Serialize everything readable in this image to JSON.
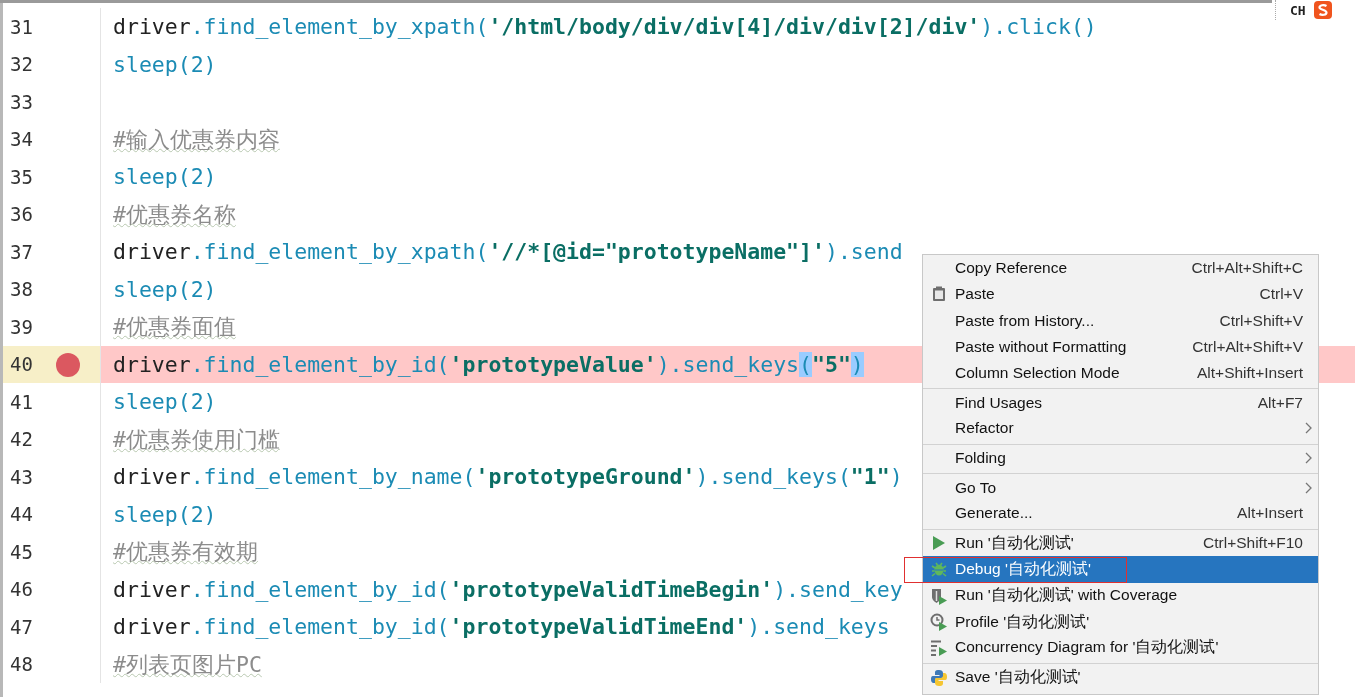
{
  "editor": {
    "lines": [
      {
        "number": "31",
        "breakpoint": false,
        "tokens": [
          {
            "kind": "plain",
            "text": "driver"
          },
          {
            "kind": "method",
            "text": ".find_element_by_xpath("
          },
          {
            "kind": "string",
            "text": "'/html/body/div/div[4]/div/div[2]/div'"
          },
          {
            "kind": "method",
            "text": ").click()"
          }
        ]
      },
      {
        "number": "32",
        "breakpoint": false,
        "tokens": [
          {
            "kind": "method",
            "text": "sleep(2)"
          }
        ]
      },
      {
        "number": "33",
        "breakpoint": false
      },
      {
        "number": "34",
        "breakpoint": false,
        "tokens": [
          {
            "kind": "comment",
            "text": "#输入优惠券内容"
          }
        ]
      },
      {
        "number": "35",
        "breakpoint": false,
        "tokens": [
          {
            "kind": "method",
            "text": "sleep(2)"
          }
        ]
      },
      {
        "number": "36",
        "breakpoint": false,
        "tokens": [
          {
            "kind": "comment",
            "text": "#优惠券名称"
          }
        ]
      },
      {
        "number": "37",
        "breakpoint": false,
        "tokens": [
          {
            "kind": "plain",
            "text": "driver"
          },
          {
            "kind": "method",
            "text": ".find_element_by_xpath("
          },
          {
            "kind": "string",
            "text": "'//*[@id=\"prototypeName\"]'"
          },
          {
            "kind": "method",
            "text": ").send"
          }
        ]
      },
      {
        "number": "38",
        "breakpoint": false,
        "tokens": [
          {
            "kind": "method",
            "text": "sleep(2)"
          }
        ]
      },
      {
        "number": "39",
        "breakpoint": false,
        "tokens": [
          {
            "kind": "comment",
            "text": "#优惠券面值"
          }
        ]
      },
      {
        "number": "40",
        "breakpoint": true,
        "tokens": [
          {
            "kind": "plain",
            "text": "driver"
          },
          {
            "kind": "method",
            "text": ".find_element_by_id("
          },
          {
            "kind": "string",
            "text": "'prototypeValue'"
          },
          {
            "kind": "method",
            "text": ").send_keys"
          },
          {
            "kind": "match",
            "text": "("
          },
          {
            "kind": "string",
            "text": "\"5\""
          },
          {
            "kind": "match",
            "text": ")"
          }
        ]
      },
      {
        "number": "41",
        "breakpoint": false,
        "tokens": [
          {
            "kind": "method",
            "text": "sleep(2)"
          }
        ]
      },
      {
        "number": "42",
        "breakpoint": false,
        "tokens": [
          {
            "kind": "comment",
            "text": "#优惠券使用门槛"
          }
        ]
      },
      {
        "number": "43",
        "breakpoint": false,
        "tokens": [
          {
            "kind": "plain",
            "text": "driver"
          },
          {
            "kind": "method",
            "text": ".find_element_by_name("
          },
          {
            "kind": "string",
            "text": "'prototypeGround'"
          },
          {
            "kind": "method",
            "text": ").send_keys("
          },
          {
            "kind": "string",
            "text": "\"1\""
          },
          {
            "kind": "method",
            "text": ")"
          }
        ]
      },
      {
        "number": "44",
        "breakpoint": false,
        "tokens": [
          {
            "kind": "method",
            "text": "sleep(2)"
          }
        ]
      },
      {
        "number": "45",
        "breakpoint": false,
        "tokens": [
          {
            "kind": "comment",
            "text": "#优惠券有效期"
          }
        ]
      },
      {
        "number": "46",
        "breakpoint": false,
        "tokens": [
          {
            "kind": "plain",
            "text": "driver"
          },
          {
            "kind": "method",
            "text": ".find_element_by_id("
          },
          {
            "kind": "string",
            "text": "'prototypeValidTimeBegin'"
          },
          {
            "kind": "method",
            "text": ").send_key"
          }
        ]
      },
      {
        "number": "47",
        "breakpoint": false,
        "tokens": [
          {
            "kind": "plain",
            "text": "driver"
          },
          {
            "kind": "method",
            "text": ".find_element_by_id("
          },
          {
            "kind": "string",
            "text": "'prototypeValidTimeEnd'"
          },
          {
            "kind": "method",
            "text": ").send_keys"
          }
        ]
      },
      {
        "number": "48",
        "breakpoint": false,
        "tokens": [
          {
            "kind": "comment",
            "text": "#列表页图片PC"
          }
        ]
      }
    ]
  },
  "context_menu": {
    "items": [
      {
        "label": "Copy Reference",
        "shortcut": "Ctrl+Alt+Shift+C",
        "submenu": false,
        "selected": false,
        "separator_after": false
      },
      {
        "label": "Paste",
        "shortcut": "Ctrl+V",
        "kind": "paste",
        "submenu": false,
        "selected": false,
        "separator_after": false
      },
      {
        "label": "Paste from History...",
        "shortcut": "Ctrl+Shift+V",
        "submenu": false,
        "selected": false,
        "separator_after": false
      },
      {
        "label": "Paste without Formatting",
        "shortcut": "Ctrl+Alt+Shift+V",
        "submenu": false,
        "selected": false,
        "separator_after": false
      },
      {
        "label": "Column Selection Mode",
        "shortcut": "Alt+Shift+Insert",
        "submenu": false,
        "selected": false,
        "separator_after": true
      },
      {
        "label": "Find Usages",
        "shortcut": "Alt+F7",
        "submenu": false,
        "selected": false,
        "separator_after": false
      },
      {
        "label": "Refactor",
        "submenu": true,
        "selected": false,
        "separator_after": true
      },
      {
        "label": "Folding",
        "submenu": true,
        "selected": false,
        "separator_after": true
      },
      {
        "label": "Go To",
        "submenu": true,
        "selected": false,
        "separator_after": false
      },
      {
        "label": "Generate...",
        "shortcut": "Alt+Insert",
        "submenu": false,
        "selected": false,
        "separator_after": true
      },
      {
        "label": "Run '自动化测试'",
        "shortcut": "Ctrl+Shift+F10",
        "kind": "run",
        "submenu": false,
        "selected": false,
        "separator_after": false
      },
      {
        "label": "Debug '自动化测试'",
        "kind": "debug",
        "submenu": false,
        "selected": true,
        "separator_after": false
      },
      {
        "label": "Run '自动化测试' with Coverage",
        "kind": "coverage",
        "submenu": false,
        "selected": false,
        "separator_after": false
      },
      {
        "label": "Profile '自动化测试'",
        "kind": "profile",
        "submenu": false,
        "selected": false,
        "separator_after": false
      },
      {
        "label": "Concurrency Diagram for '自动化测试'",
        "kind": "concurrency",
        "submenu": false,
        "selected": false,
        "separator_after": true
      },
      {
        "label": "Save '自动化测试'",
        "kind": "python",
        "submenu": false,
        "selected": false,
        "separator_after": false
      }
    ]
  },
  "input_indicator": {
    "label": "CH"
  }
}
